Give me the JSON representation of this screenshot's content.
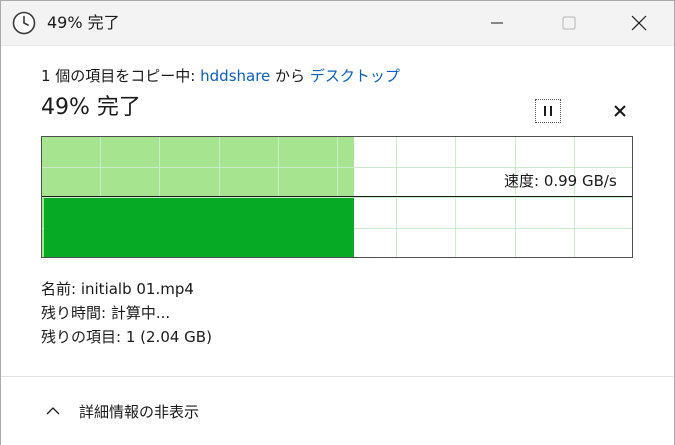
{
  "window": {
    "title": "49% 完了",
    "icon": "clock-icon"
  },
  "header": {
    "prefix": "1 個の項目をコピー中: ",
    "source": "hddshare",
    "middle": " から ",
    "destination": "デスクトップ",
    "progress_text": "49% 完了",
    "progress_percent": 49
  },
  "speed": {
    "label": "速度: 0.99 GB/s",
    "value_gb_per_s": 0.99
  },
  "details": {
    "name_label": "名前:",
    "name_value": "initialb 01.mp4",
    "time_label": "残り時間:",
    "time_value": "計算中...",
    "items_label": "残りの項目:",
    "items_value": "1 (2.04 GB)"
  },
  "footer": {
    "toggle_label": "詳細情報の非表示"
  },
  "colors": {
    "progress_fill": "#a6e490",
    "speed_fill": "#06aa25",
    "grid": "#cbeccb",
    "link": "#0a5fbf"
  }
}
